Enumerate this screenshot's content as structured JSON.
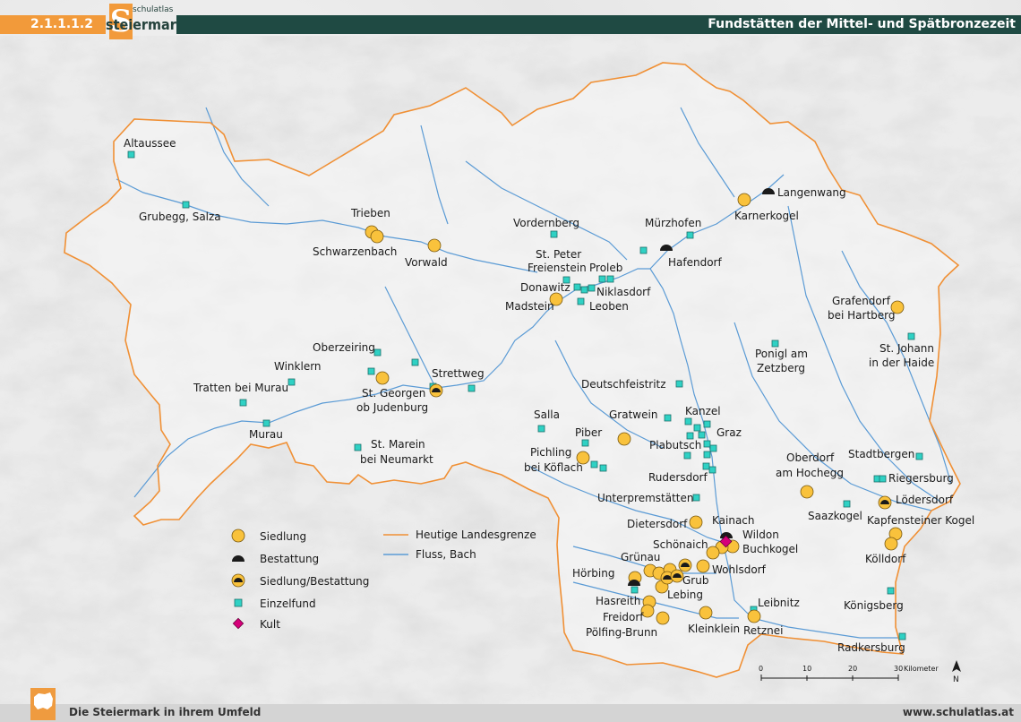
{
  "header": {
    "code": "2.1.1.1.2",
    "logo_small": "schulatlas",
    "logo_big": "steiermark",
    "logo_letter": "S",
    "title": "Fundstätten der Mittel- und Spätbronzezeit"
  },
  "footer": {
    "left": "Die Steiermark in ihrem Umfeld",
    "right": "www.schulatlas.at"
  },
  "legend": {
    "siedlung": "Siedlung",
    "bestattung": "Bestattung",
    "siedlung_bestattung": "Siedlung/Bestattung",
    "einzelfund": "Einzelfund",
    "kult": "Kult",
    "landesgrenze": "Heutige Landesgrenze",
    "fluss": "Fluss, Bach"
  },
  "scale": {
    "ticks": [
      "0",
      "10",
      "20",
      "30"
    ],
    "unit": "Kilometer",
    "north": "N"
  },
  "colors": {
    "siedlung": "#f9c23c",
    "bestattung": "#1a1a1a",
    "einzelfund": "#2fd1c4",
    "kult": "#d6007a",
    "border": "#f09035",
    "river": "#5b9bd5",
    "header_bar": "#1f4a43",
    "header_code": "#f29a3a"
  },
  "places": {
    "altaussee": "Altaussee",
    "grubegg": "Grubegg, Salza",
    "trieben": "Trieben",
    "schwarzenbach": "Schwarzenbach",
    "vorwald": "Vorwald",
    "vordernberg": "Vordernberg",
    "stpeter": "St. Peter",
    "freienstein": "Freienstein",
    "proleb": "Proleb",
    "donawitz": "Donawitz",
    "niklasdorf": "Niklasdorf",
    "madstein": "Madstein",
    "leoben": "Leoben",
    "muerzhofen": "Mürzhofen",
    "hafendorf": "Hafendorf",
    "langenwang": "Langenwang",
    "karnerkogel": "Karnerkogel",
    "grafendorf1": "Grafendorf",
    "grafendorf2": "bei Hartberg",
    "stjohann1": "St. Johann",
    "stjohann2": "in der Haide",
    "ponigl1": "Ponigl am",
    "ponigl2": "Zetzberg",
    "oberzeiring": "Oberzeiring",
    "winklern": "Winklern",
    "tratten": "Tratten bei Murau",
    "strettweg": "Strettweg",
    "stgeorgen1": "St. Georgen",
    "stgeorgen2": "ob Judenburg",
    "murau": "Murau",
    "stmarein1": "St. Marein",
    "stmarein2": "bei Neumarkt",
    "deutschfeistritz": "Deutschfeistritz",
    "salla": "Salla",
    "gratwein": "Gratwein",
    "kanzel": "Kanzel",
    "piber": "Piber",
    "graz": "Graz",
    "plabutsch": "Plabutsch",
    "pichling1": "Pichling",
    "pichling2": "bei Köflach",
    "rudersdorf": "Rudersdorf",
    "unterpremstaetten": "Unterpremstätten",
    "oberdorf1": "Oberdorf",
    "oberdorf2": "am Hochegg",
    "stadtbergen": "Stadtbergen",
    "riegersburg": "Riegersburg",
    "loedersdorf": "Lödersdorf",
    "saazkogel": "Saazkogel",
    "kapfensteiner": "Kapfensteiner Kogel",
    "dietersdorf": "Dietersdorf",
    "kainach": "Kainach",
    "wildon": "Wildon",
    "buchkogel": "Buchkogel",
    "schoenaich": "Schönaich",
    "gruenau": "Grünau",
    "wohlsdorf": "Wohlsdorf",
    "hoerbing": "Hörbing",
    "grub": "Grub",
    "lebing": "Lebing",
    "hasreith": "Hasreith",
    "freidorf": "Freidorf",
    "leibnitz": "Leibnitz",
    "koelldorf": "Kölldorf",
    "koenigsberg": "Königsberg",
    "poelfing": "Pölfing-Brunn",
    "kleinklein": "Kleinklein",
    "retznei": "Retznei",
    "radkersburg": "Radkersburg"
  }
}
